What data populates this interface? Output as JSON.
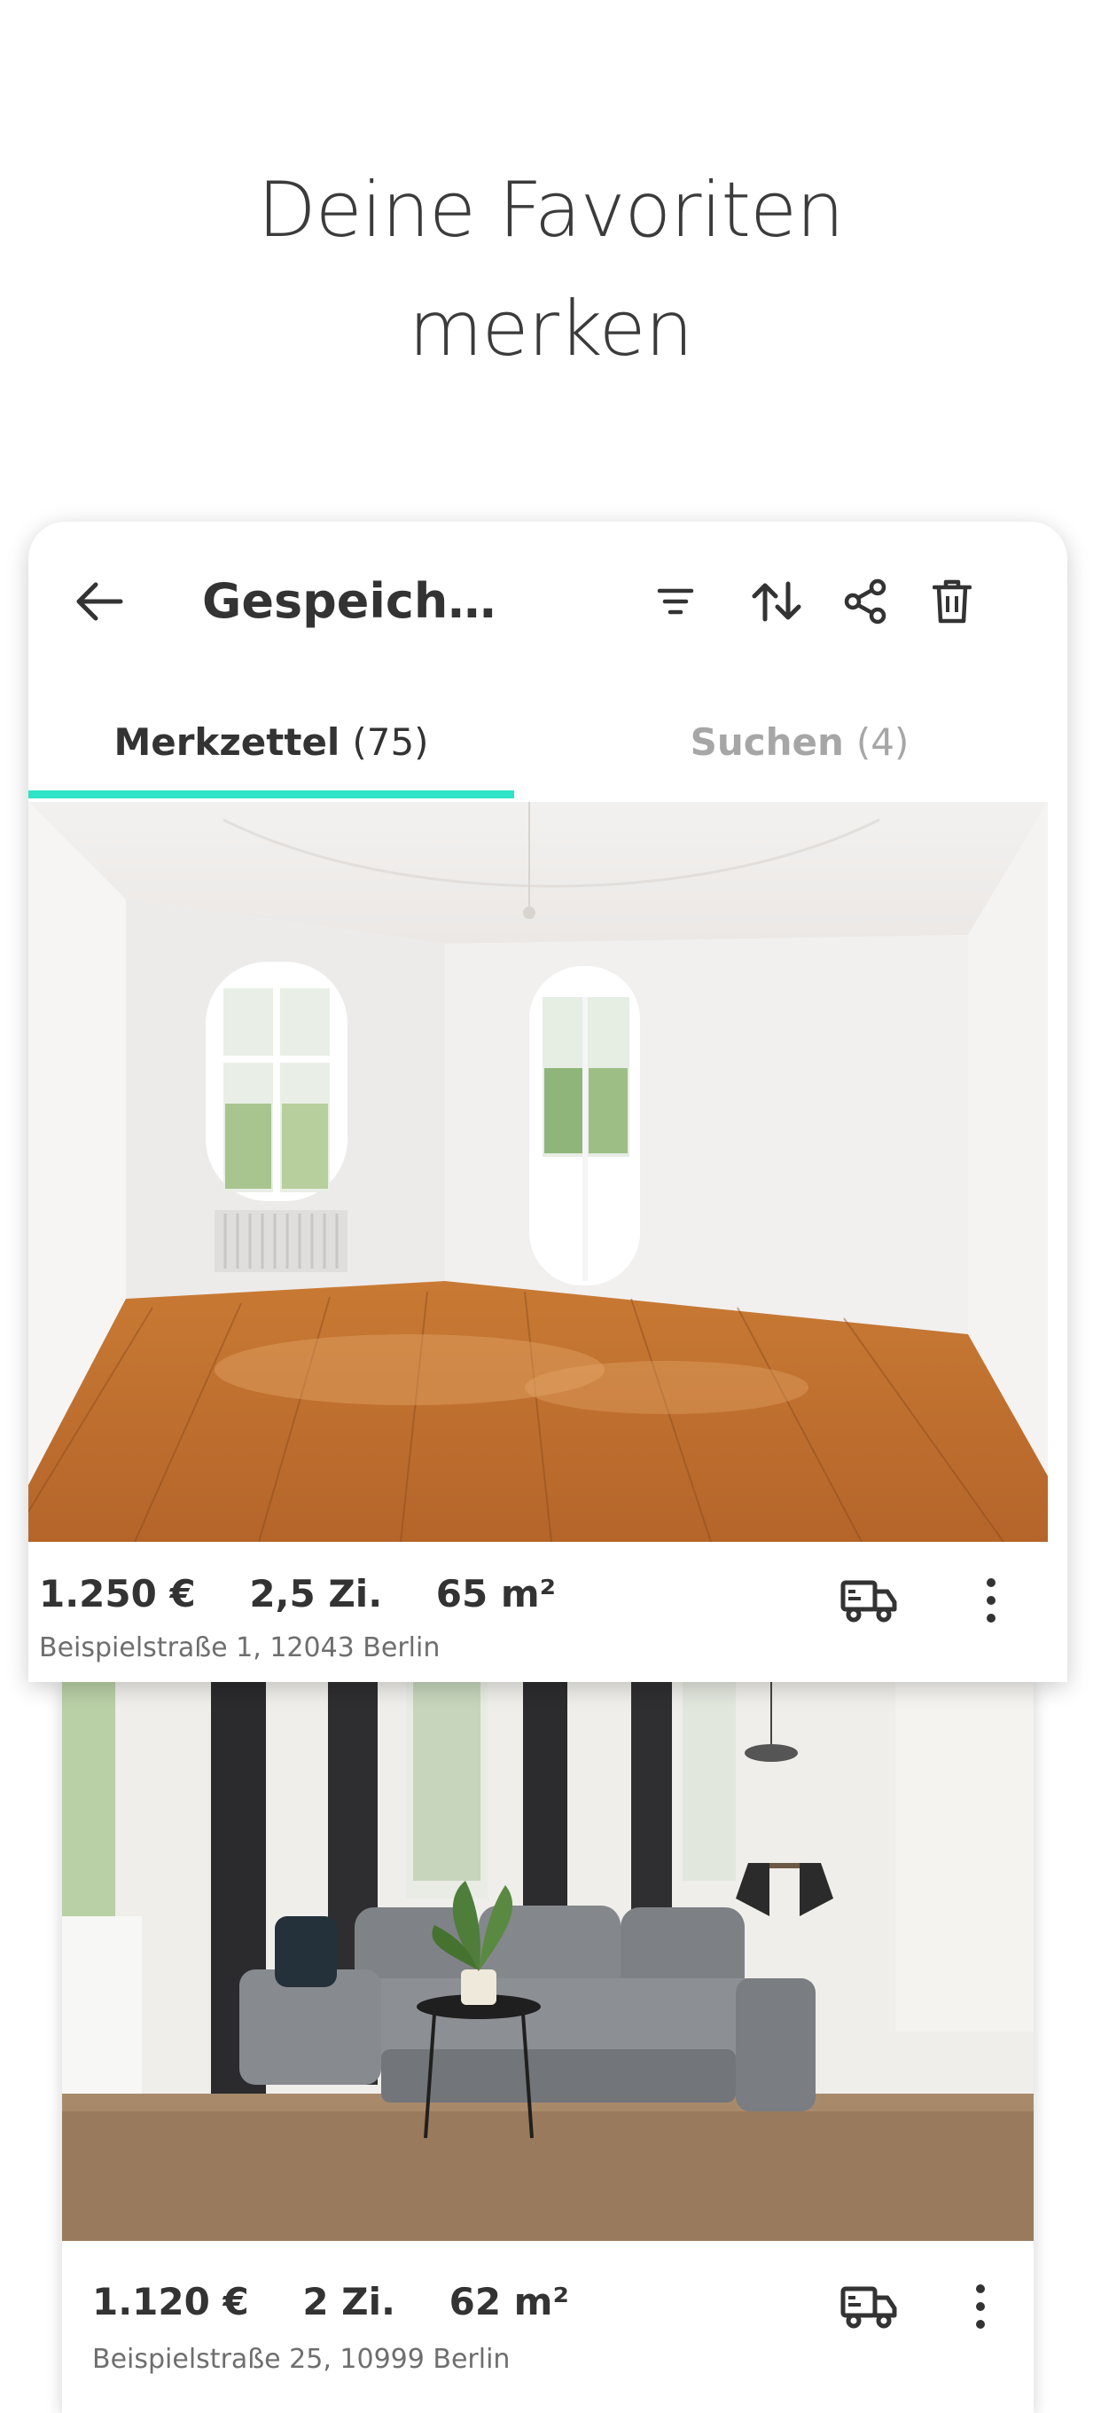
{
  "headline": {
    "line1_part1": "Deine",
    "line1_highlight": "Favoriten",
    "line2": "merken"
  },
  "appbar": {
    "title": "Gespeich…",
    "icons": [
      "back-arrow-icon",
      "filter-icon",
      "sort-icon",
      "share-icon",
      "trash-icon"
    ]
  },
  "tabs": [
    {
      "label": "Merkzettel",
      "count": "(75)",
      "active": true
    },
    {
      "label": "Suchen",
      "count": "(4)",
      "active": false
    }
  ],
  "listings": [
    {
      "price": "1.250 €",
      "rooms": "2,5 Zi.",
      "area": "65 m²",
      "address": "Beispielstraße 1, 12043 Berlin"
    },
    {
      "price": "1.120 €",
      "rooms": "2 Zi.",
      "area": "62 m²",
      "address": "Beispielstraße 25, 10999 Berlin"
    }
  ],
  "colors": {
    "accent_tab": "#2fe3c6",
    "highlight_stroke": "#f6921e",
    "text_primary": "#333333",
    "text_muted": "#a6a6a6"
  }
}
